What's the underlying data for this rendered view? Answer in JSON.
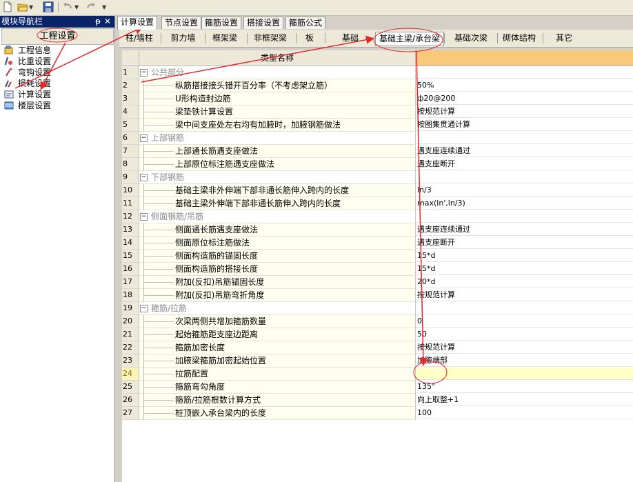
{
  "toolbar": {
    "icons": [
      "new-file-icon",
      "open-folder-icon",
      "save-icon",
      "undo-icon",
      "redo-icon"
    ]
  },
  "nav": {
    "title": "模块导航栏",
    "pin": "ᵽ",
    "close": "✕",
    "group": "工程设置",
    "items": [
      {
        "label": "工程信息",
        "icon": "project-info-icon"
      },
      {
        "label": "比重设置",
        "icon": "density-icon"
      },
      {
        "label": "弯钩设置",
        "icon": "hook-icon"
      },
      {
        "label": "损耗设置",
        "icon": "loss-icon"
      },
      {
        "label": "计算设置",
        "icon": "calc-icon"
      },
      {
        "label": "楼层设置",
        "icon": "floor-icon"
      }
    ]
  },
  "tabs": [
    {
      "label": "计算设置",
      "active": true
    },
    {
      "label": "节点设置"
    },
    {
      "label": "箍筋设置"
    },
    {
      "label": "搭接设置"
    },
    {
      "label": "箍筋公式"
    }
  ],
  "subtabs": [
    {
      "label": "柱/墙柱"
    },
    {
      "label": "剪力墙"
    },
    {
      "label": "框架梁"
    },
    {
      "label": "非框架梁"
    },
    {
      "label": "板"
    },
    {
      "label": "基础"
    },
    {
      "label": "基础主梁/承台梁",
      "active": true
    },
    {
      "label": "基础次梁"
    },
    {
      "label": "砌体结构"
    },
    {
      "label": "其它"
    }
  ],
  "grid": {
    "header_name": "类型名称",
    "header_value": "",
    "rows": [
      {
        "num": "1",
        "name": "公共部分",
        "value": "",
        "group": true
      },
      {
        "num": "2",
        "name": "纵筋搭接接头错开百分率（不考虑架立筋）",
        "value": "50%"
      },
      {
        "num": "3",
        "name": "U形构造封边筋",
        "value": "ф20@200"
      },
      {
        "num": "4",
        "name": "梁垫铁计算设置",
        "value": "按规范计算"
      },
      {
        "num": "5",
        "name": "梁中间支座处左右均有加腋时，加腋钢筋做法",
        "value": "按图集贯通计算"
      },
      {
        "num": "6",
        "name": "上部钢筋",
        "value": "",
        "group": true
      },
      {
        "num": "7",
        "name": "上部通长筋遇支座做法",
        "value": "遇支座连续通过"
      },
      {
        "num": "8",
        "name": "上部原位标注筋遇支座做法",
        "value": "遇支座断开"
      },
      {
        "num": "9",
        "name": "下部钢筋",
        "value": "",
        "group": true
      },
      {
        "num": "10",
        "name": "基础主梁非外伸端下部非通长筋伸入跨内的长度",
        "value": "ln/3"
      },
      {
        "num": "11",
        "name": "基础主梁外伸端下部非通长筋伸入跨内的长度",
        "value": "max(ln',ln/3)"
      },
      {
        "num": "12",
        "name": "侧面钢筋/吊筋",
        "value": "",
        "group": true
      },
      {
        "num": "13",
        "name": "侧面通长筋遇支座做法",
        "value": "遇支座连续通过"
      },
      {
        "num": "14",
        "name": "侧面原位标注筋做法",
        "value": "遇支座断开"
      },
      {
        "num": "15",
        "name": "侧面构造筋的锚固长度",
        "value": "15*d"
      },
      {
        "num": "16",
        "name": "侧面构造筋的搭接长度",
        "value": "15*d"
      },
      {
        "num": "17",
        "name": "附加(反扣)吊筋锚固长度",
        "value": "20*d"
      },
      {
        "num": "18",
        "name": "附加(反扣)吊筋弯折角度",
        "value": "按规范计算"
      },
      {
        "num": "19",
        "name": "箍筋/拉筋",
        "value": "",
        "group": true
      },
      {
        "num": "20",
        "name": "次梁两侧共增加箍筋数量",
        "value": "0"
      },
      {
        "num": "21",
        "name": "起始箍筋距支座边距离",
        "value": "50"
      },
      {
        "num": "22",
        "name": "箍筋加密长度",
        "value": "按规范计算"
      },
      {
        "num": "23",
        "name": "加腋梁箍筋加密起始位置",
        "value": "加腋端部"
      },
      {
        "num": "24",
        "name": "拉筋配置",
        "value": "",
        "selected": true
      },
      {
        "num": "25",
        "name": "箍筋弯勾角度",
        "value": "135°"
      },
      {
        "num": "26",
        "name": "箍筋/拉筋根数计算方式",
        "value": "向上取整+1"
      },
      {
        "num": "27",
        "name": "桩顶嵌入承台梁内的长度",
        "value": "100"
      }
    ]
  },
  "colors": {
    "annotation": "#e8262b",
    "nav_title_bg": "#0a246a",
    "header_value_bg": "#f9c87a",
    "selected_row_bg": "#ffffc8"
  }
}
